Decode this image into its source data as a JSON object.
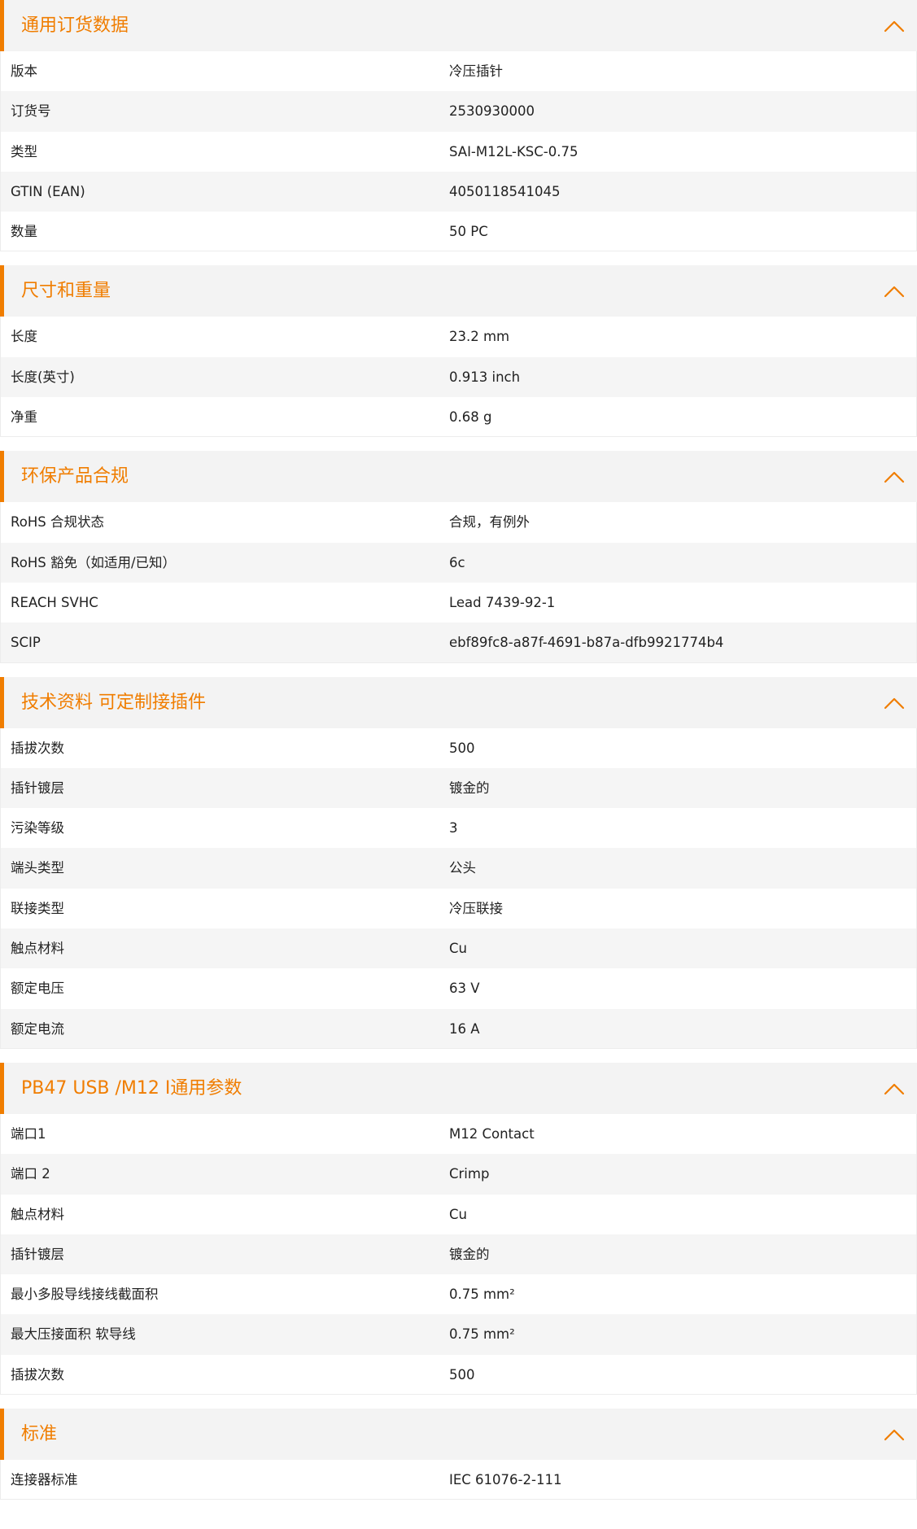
{
  "accent_color": "#f07d00",
  "collapse_icon": "chevron-up-icon",
  "sections": [
    {
      "title": "通用订货数据",
      "rows": [
        {
          "label": "版本",
          "value": "冷压插针"
        },
        {
          "label": "订货号",
          "value": "2530930000"
        },
        {
          "label": "类型",
          "value": "SAI-M12L-KSC-0.75"
        },
        {
          "label": "GTIN (EAN)",
          "value": "4050118541045"
        },
        {
          "label": "数量",
          "value": "50  PC"
        }
      ]
    },
    {
      "title": "尺寸和重量",
      "rows": [
        {
          "label": "长度",
          "value": "23.2  mm"
        },
        {
          "label": "长度(英寸)",
          "value": "0.913  inch"
        },
        {
          "label": "净重",
          "value": "0.68  g"
        }
      ]
    },
    {
      "title": "环保产品合规",
      "rows": [
        {
          "label": "RoHS 合规状态",
          "value": "合规，有例外"
        },
        {
          "label": "RoHS 豁免（如适用/已知）",
          "value": "6c"
        },
        {
          "label": "REACH SVHC",
          "value": "Lead 7439-92-1"
        },
        {
          "label": "SCIP",
          "value": "ebf89fc8-a87f-4691-b87a-dfb9921774b4"
        }
      ]
    },
    {
      "title": "技术资料 可定制接插件",
      "rows": [
        {
          "label": "插拔次数",
          "value": "500"
        },
        {
          "label": "插针镀层",
          "value": "镀金的"
        },
        {
          "label": "污染等级",
          "value": "3"
        },
        {
          "label": "端头类型",
          "value": "公头"
        },
        {
          "label": "联接类型",
          "value": "冷压联接"
        },
        {
          "label": "触点材料",
          "value": "Cu"
        },
        {
          "label": "额定电压",
          "value": "63  V"
        },
        {
          "label": "额定电流",
          "value": "16  A"
        }
      ]
    },
    {
      "title": "PB47 USB /M12 I通用参数",
      "rows": [
        {
          "label": "端口1",
          "value": "M12 Contact"
        },
        {
          "label": "端口 2",
          "value": "Crimp"
        },
        {
          "label": "触点材料",
          "value": "Cu"
        },
        {
          "label": "插针镀层",
          "value": "镀金的"
        },
        {
          "label": "最小多股导线接线截面积",
          "value": "0.75  mm²"
        },
        {
          "label": "最大压接面积 软导线",
          "value": "0.75  mm²"
        },
        {
          "label": "插拔次数",
          "value": "500"
        }
      ]
    },
    {
      "title": "标准",
      "rows": [
        {
          "label": "连接器标准",
          "value": "IEC 61076-2-111"
        }
      ]
    }
  ]
}
